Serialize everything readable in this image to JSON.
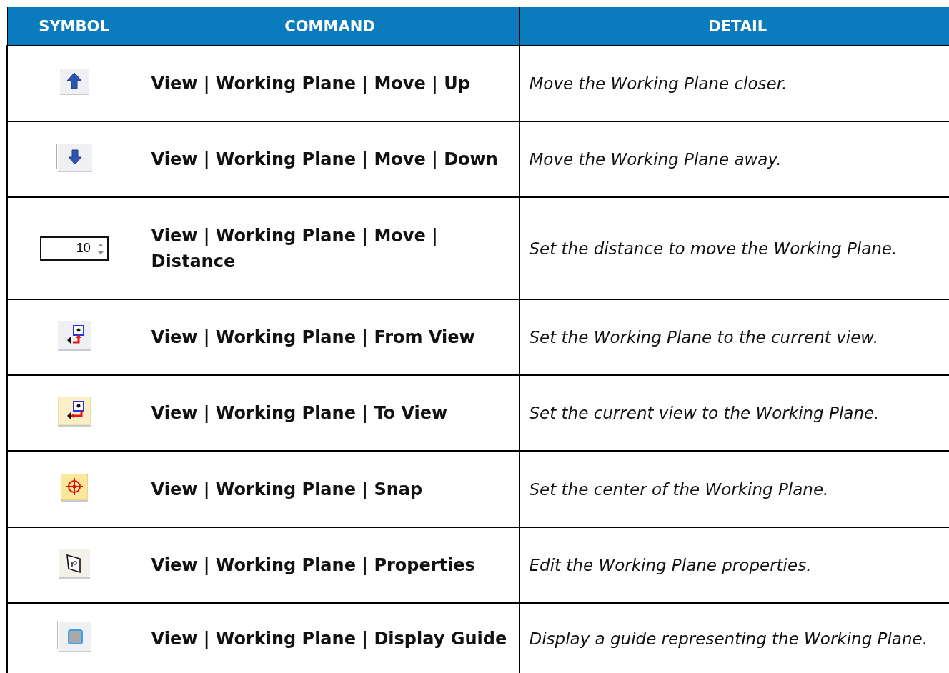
{
  "table": {
    "columns": [
      "SYMBOL",
      "COMMAND",
      "DETAIL"
    ],
    "rows": [
      {
        "symbol": {
          "kind": "arrow-up"
        },
        "command": "View | Working Plane | Move | Up",
        "detail": "Move the Working Plane closer."
      },
      {
        "symbol": {
          "kind": "arrow-down"
        },
        "command": "View | Working Plane | Move | Down",
        "detail": "Move the Working Plane away."
      },
      {
        "symbol": {
          "kind": "spinner",
          "value": "10"
        },
        "command": "View | Working Plane | Move | Distance",
        "detail": "Set the distance to move the Working Plane."
      },
      {
        "symbol": {
          "kind": "from-view"
        },
        "command": "View | Working Plane | From View",
        "detail": "Set the Working Plane to the current view."
      },
      {
        "symbol": {
          "kind": "to-view"
        },
        "command": "View | Working Plane | To View",
        "detail": "Set the current view to the Working Plane."
      },
      {
        "symbol": {
          "kind": "snap"
        },
        "command": "View | Working Plane | Snap",
        "detail": "Set the center of the Working Plane."
      },
      {
        "symbol": {
          "kind": "properties"
        },
        "command": "View | Working Plane | Properties",
        "detail": "Edit the Working Plane properties."
      },
      {
        "symbol": {
          "kind": "guide"
        },
        "command": "View | Working Plane | Display Guide",
        "detail": "Display a guide representing the Working Plane."
      }
    ]
  }
}
